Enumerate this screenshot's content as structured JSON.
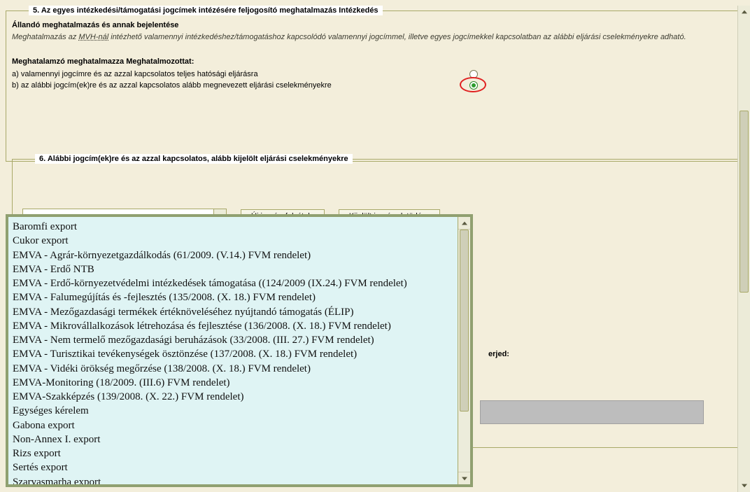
{
  "section5": {
    "legend": "5. Az egyes intézkedési/támogatási jogcímek intézésére feljogosító meghatalmazás Intézkedés",
    "subheading": "Állandó meghatalmazás és annak bejelentése",
    "description_pre": "Meghatalmazás az ",
    "description_abbr": "MVH-nál",
    "description_post": " intézhető valamennyi intézkedéshez/támogatáshoz kapcsolódó valamennyi jogcímmel, illetve egyes jogcímekkel kapcsolatban az alábbi eljárási cselekményekre adható.",
    "auth_title": "Meghatalamzó meghatalmazza Meghatalmozottat:",
    "option_a": "a) valamennyi jogcímre és az azzal kapcsolatos teljes hatósági eljárásra",
    "option_b": "b) az alábbi jogcím(ek)re és az azzal kapcsolatos alább megnevezett eljárási cselekményekre"
  },
  "section6": {
    "legend": "6. Alábbi jogcím(ek)re és az azzal kapcsolatos, alább kijelölt eljárási cselekményekre",
    "combo_value": "",
    "btn_add": "Új jogcím felvétele",
    "btn_delete": "Kijelölt jogcímek törlése",
    "hidden_label_suffix": "erjed:"
  },
  "dropdown_options": [
    "Baromfi export",
    "Cukor export",
    "EMVA - Agrár-környezetgazdálkodás (61/2009. (V.14.) FVM rendelet)",
    "EMVA - Erdő NTB",
    "EMVA - Erdő-környezetvédelmi intézkedések támogatása ((124/2009 (IX.24.) FVM rendelet)",
    "EMVA - Falumegújítás és -fejlesztés (135/2008. (X. 18.) FVM rendelet)",
    "EMVA - Mezőgazdasági termékek értéknöveléséhez nyújtandó támogatás (ÉLIP)",
    "EMVA - Mikrovállalkozások létrehozása és fejlesztése (136/2008. (X. 18.) FVM rendelet)",
    "EMVA - Nem termelő mezőgazdasági beruházások (33/2008. (III. 27.) FVM rendelet)",
    "EMVA - Turisztikai tevékenységek ösztönzése (137/2008. (X. 18.) FVM rendelet)",
    "EMVA - Vidéki örökség megőrzése (138/2008. (X. 18.) FVM rendelet)",
    "EMVA-Monitoring (18/2009. (III.6) FVM rendelet)",
    "EMVA-Szakképzés (139/2008. (X. 22.) FVM rendelet)",
    "Egységes kérelem",
    "Gabona export",
    "Non-Annex I. export",
    "Rizs export",
    "Sertés export",
    "Szarvasmarha export"
  ]
}
